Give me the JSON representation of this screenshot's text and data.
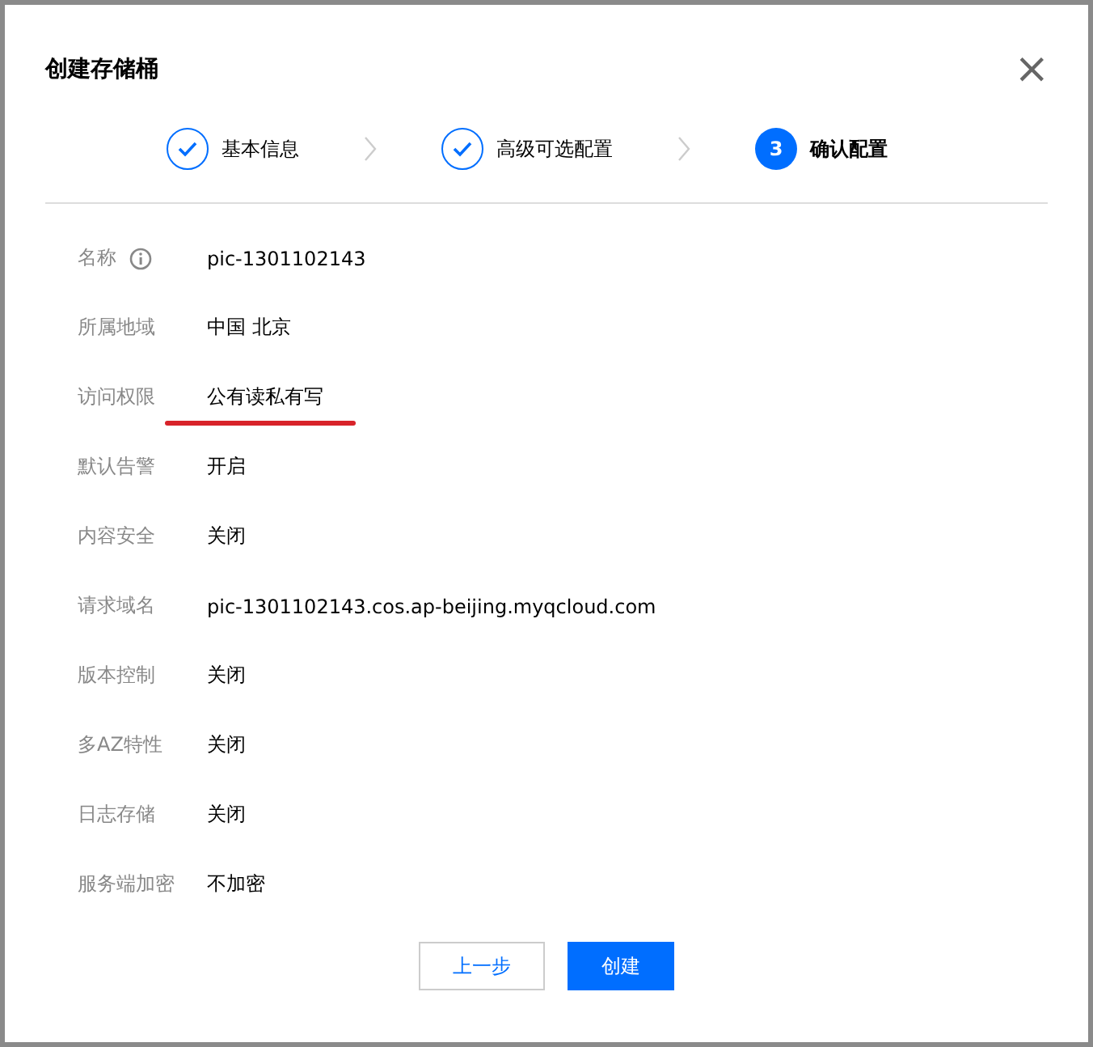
{
  "dialog": {
    "title": "创建存储桶",
    "close": "×"
  },
  "steps": [
    {
      "label": "基本信息",
      "done": true
    },
    {
      "label": "高级可选配置",
      "done": true
    },
    {
      "label": "确认配置",
      "number": "3",
      "done": false
    }
  ],
  "fields": [
    {
      "label": "名称",
      "value": "pic-1301102143",
      "info": true,
      "underlined": false
    },
    {
      "label": "所属地域",
      "value": "中国 北京",
      "info": false,
      "underlined": false
    },
    {
      "label": "访问权限",
      "value": "公有读私有写",
      "info": false,
      "underlined": true
    },
    {
      "label": "默认告警",
      "value": "开启",
      "info": false,
      "underlined": false
    },
    {
      "label": "内容安全",
      "value": "关闭",
      "info": false,
      "underlined": false
    },
    {
      "label": "请求域名",
      "value": "pic-1301102143.cos.ap-beijing.myqcloud.com",
      "info": false,
      "underlined": false
    },
    {
      "label": "版本控制",
      "value": "关闭",
      "info": false,
      "underlined": false
    },
    {
      "label": "多AZ特性",
      "value": "关闭",
      "info": false,
      "underlined": false
    },
    {
      "label": "日志存储",
      "value": "关闭",
      "info": false,
      "underlined": false
    },
    {
      "label": "服务端加密",
      "value": "不加密",
      "info": false,
      "underlined": false
    }
  ],
  "buttons": [
    {
      "label": "上一步",
      "kind": "secondary"
    },
    {
      "label": "创建",
      "kind": "primary"
    }
  ]
}
